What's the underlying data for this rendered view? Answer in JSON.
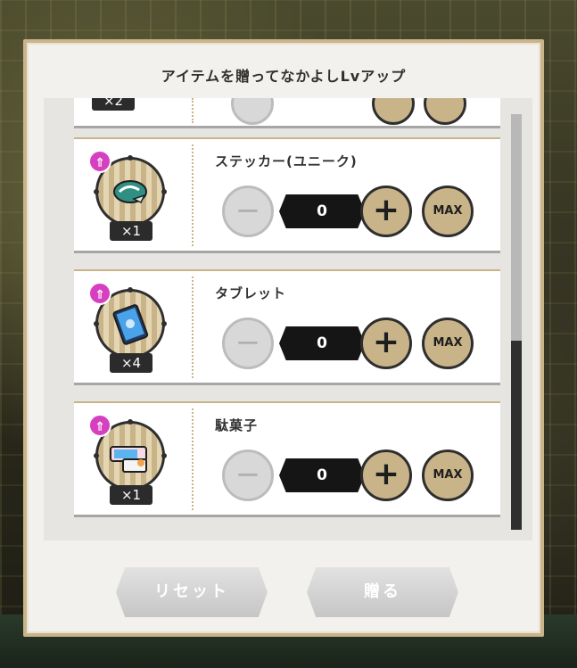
{
  "modal": {
    "title": "アイテムを贈ってなかよしLvアップ",
    "reset_label": "リセット",
    "give_label": "贈る"
  },
  "items": [
    {
      "name": "",
      "count": "×2",
      "quantity": "",
      "partial": true
    },
    {
      "name": "ステッカー(ユニーク)",
      "count": "×1",
      "quantity": "0",
      "icon": "sticker-icon"
    },
    {
      "name": "タブレット",
      "count": "×4",
      "quantity": "0",
      "icon": "tablet-icon"
    },
    {
      "name": "駄菓子",
      "count": "×1",
      "quantity": "0",
      "icon": "candy-icon"
    }
  ],
  "controls": {
    "minus": "−",
    "plus": "+",
    "max": "MAX"
  },
  "colors": {
    "gold": "#c9b48a",
    "rank": "#d63fbf",
    "dark": "#2e2e2e"
  }
}
